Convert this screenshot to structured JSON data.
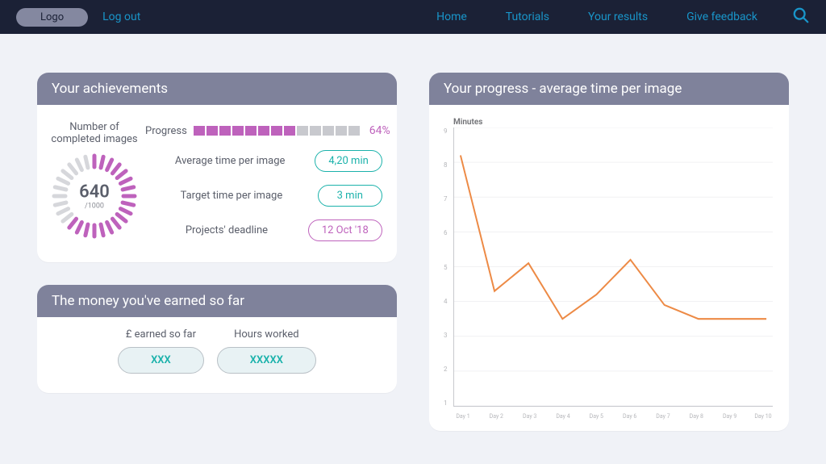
{
  "nav": {
    "logo": "Logo",
    "logout": "Log out",
    "links": [
      "Home",
      "Tutorials",
      "Your results",
      "Give feedback"
    ]
  },
  "achievements": {
    "title": "Your achievements",
    "completed_label": "Number of completed images",
    "completed_value": "640",
    "completed_total": "/1000",
    "donut_percent": 64,
    "progress_label": "Progress",
    "progress_segments": 13,
    "progress_filled": 8,
    "progress_pct": "64%",
    "avg_label": "Average time per image",
    "avg_value": "4,20 min",
    "target_label": "Target time per image",
    "target_value": "3 min",
    "deadline_label": "Projects' deadline",
    "deadline_value": "12  Oct '18"
  },
  "earnings": {
    "title": "The money you've earned so far",
    "earned_label": "£  earned so far",
    "earned_value": "XXX",
    "hours_label": "Hours worked",
    "hours_value": "XXXXX"
  },
  "progress_chart": {
    "title": "Your progress - average time per image",
    "ylabel": "Minutes"
  },
  "chart_data": {
    "type": "line",
    "title": "Your progress - average time per image",
    "ylabel": "Minutes",
    "xlabel": "",
    "ylim": [
      1,
      9
    ],
    "categories": [
      "Day 1",
      "Day 2",
      "Day 3",
      "Day 4",
      "Day 5",
      "Day 6",
      "Day 7",
      "Day 8",
      "Day 9",
      "Day 10"
    ],
    "values": [
      8.2,
      4.3,
      5.1,
      3.5,
      4.2,
      5.2,
      3.9,
      3.5,
      3.5,
      3.5
    ]
  },
  "colors": {
    "accent_purple": "#be62bc",
    "accent_teal": "#1bb2ab",
    "chart_line": "#ed8a45"
  }
}
